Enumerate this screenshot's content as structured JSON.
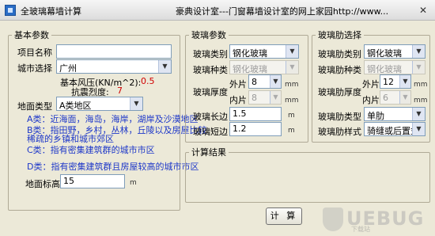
{
  "window": {
    "title": "全玻璃幕墙计算",
    "caption": "豪典设计室---门窗幕墙设计室的网上家园http://www..."
  },
  "basic": {
    "legend": "基本参数",
    "project_label": "项目名称",
    "project_value": "",
    "city_label": "城市选择",
    "city_value": "广州",
    "wind_label": "基本风压(KN/m^2):",
    "wind_value": "0.5",
    "quake_label": "抗震烈度:",
    "quake_value": "7",
    "terrain_label": "地面类型",
    "terrain_value": "A类地区",
    "terrain_a": "A类：近海面，海岛，海岸，湖岸及沙漠地区",
    "terrain_b_1": "B类：指田野，乡村，丛林，丘陵以及房屋比较",
    "terrain_b_2": "稀疏的乡镇和城市郊区",
    "terrain_c": "C类：指有密集建筑群的城市市区",
    "terrain_d": "D类：指有密集建筑群且房屋较高的城市市区",
    "height_label": "地面标高",
    "height_value": "15",
    "height_unit": "m"
  },
  "glass": {
    "legend": "玻璃参数",
    "type_label": "玻璃类别",
    "type_value": "钢化玻璃",
    "kind_label": "玻璃种类",
    "kind_value": "钢化玻璃",
    "thickness_label": "玻璃厚度",
    "outer_label": "外片",
    "outer_value": "8",
    "inner_label": "内片",
    "inner_value": "8",
    "mm": "mm",
    "long_label": "玻璃长边",
    "long_value": "1.5",
    "short_label": "玻璃短边",
    "short_value": "1.2",
    "m": "m"
  },
  "rib": {
    "legend": "玻璃肋选择",
    "type_label": "玻璃肋类别",
    "type_value": "钢化玻璃",
    "kind_label": "玻璃肋种类",
    "kind_value": "钢化玻璃",
    "thickness_label": "玻璃肋厚度",
    "outer_label": "外片",
    "outer_value": "12",
    "inner_label": "内片",
    "inner_value": "6",
    "mm": "mm",
    "rib_type_label": "玻璃肋类型",
    "rib_type_value": "单肋",
    "rib_style_label": "玻璃肋样式",
    "rib_style_value": "骑缝或后置式"
  },
  "result": {
    "legend": "计算结果"
  },
  "actions": {
    "calc_label": "计 算"
  },
  "watermark": {
    "text": "UEBUG",
    "sub": "下载站"
  }
}
